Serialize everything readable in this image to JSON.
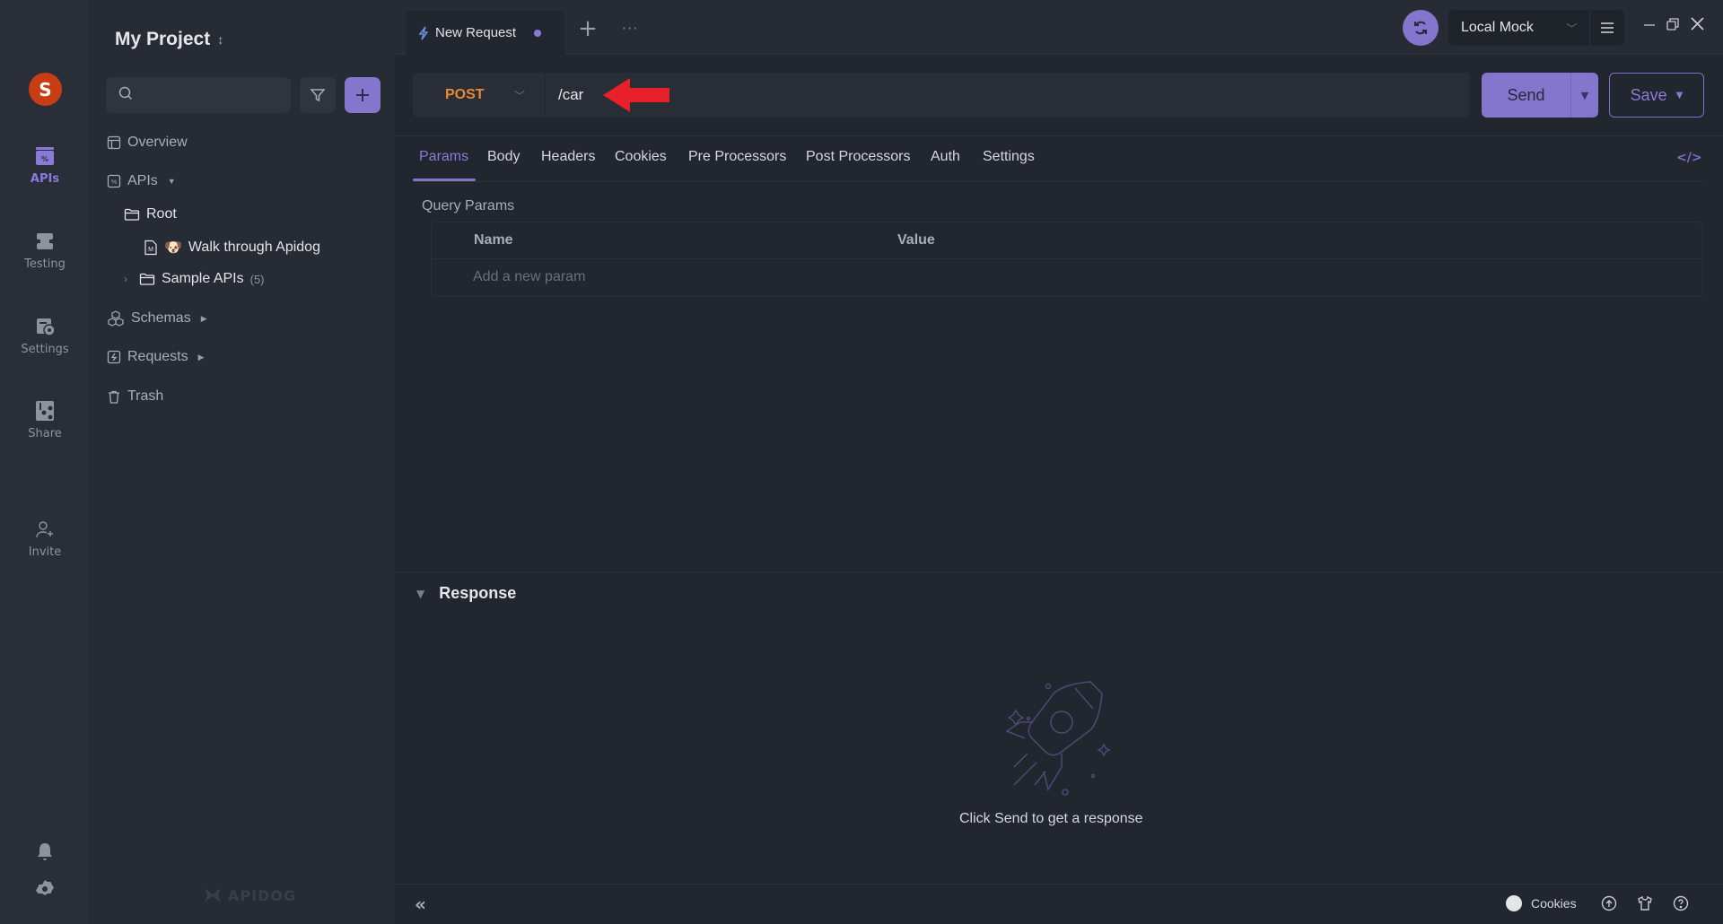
{
  "rail": {
    "avatar_initial": "S",
    "items": [
      {
        "label": "APIs",
        "icon": "apis-icon",
        "active": true
      },
      {
        "label": "Testing",
        "icon": "testing-icon",
        "active": false
      },
      {
        "label": "Settings",
        "icon": "settings-icon",
        "active": false
      },
      {
        "label": "Share",
        "icon": "share-icon",
        "active": false
      },
      {
        "label": "Invite",
        "icon": "invite-icon",
        "active": false
      }
    ],
    "bottom_icons": [
      "bell-icon",
      "gear-icon"
    ]
  },
  "sidebar": {
    "project_title": "My Project",
    "project_switch_icon": "↕",
    "search_placeholder": "",
    "tree": {
      "overview": "Overview",
      "apis": "APIs",
      "root": "Root",
      "walk_through": "Walk through Apidog",
      "sample_apis": "Sample APIs",
      "sample_apis_count": "(5)",
      "schemas": "Schemas",
      "requests": "Requests",
      "trash": "Trash"
    },
    "watermark": "APIDOG"
  },
  "topbar": {
    "tab_title": "New Request",
    "tab_unsaved": true,
    "new_tab": "+",
    "more": "···",
    "environment": "Local Mock"
  },
  "request": {
    "method": "POST",
    "url": "/car",
    "send_label": "Send",
    "save_label": "Save"
  },
  "param_tabs": [
    "Params",
    "Body",
    "Headers",
    "Cookies",
    "Pre Processors",
    "Post Processors",
    "Auth",
    "Settings"
  ],
  "active_param_tab": "Params",
  "query_params": {
    "label": "Query Params",
    "columns": [
      "Name",
      "Value"
    ],
    "add_placeholder": "Add a new param",
    "rows": []
  },
  "response": {
    "title": "Response",
    "hint": "Click Send to get a response"
  },
  "bottombar": {
    "cookies_label": "Cookies",
    "collapse": "«"
  },
  "colors": {
    "accent": "#8476cc",
    "method_post": "#e58a38",
    "avatar": "#c93d12",
    "annotation_arrow": "#e8202a"
  }
}
